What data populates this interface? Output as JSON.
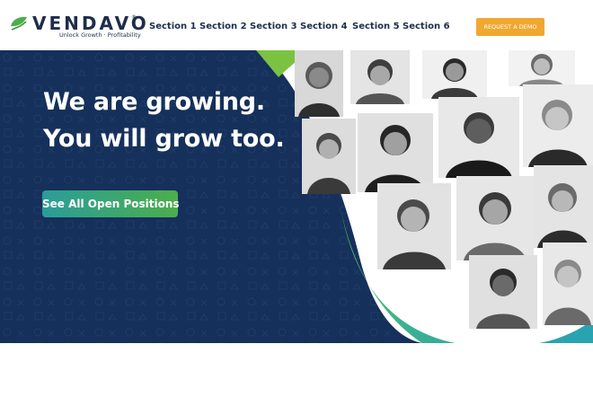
{
  "brand": {
    "name": "VENDAVO",
    "trademark": "®",
    "tagline": "Unlock Growth · Profitability",
    "colors": {
      "navy": "#1f2c4c",
      "green": "#4cae4c",
      "teal": "#2a9d9a",
      "orange": "#f0a830"
    }
  },
  "nav": {
    "items": [
      "Section 1",
      "Section 2",
      "Section 3",
      "Section 4",
      "Section 5",
      "Section 6"
    ]
  },
  "header": {
    "demo_label": "REQUEST A DEMO"
  },
  "hero": {
    "title_line1": "We are growing.",
    "title_line2": "You will grow too.",
    "cta_label": "See All Open Positions"
  }
}
